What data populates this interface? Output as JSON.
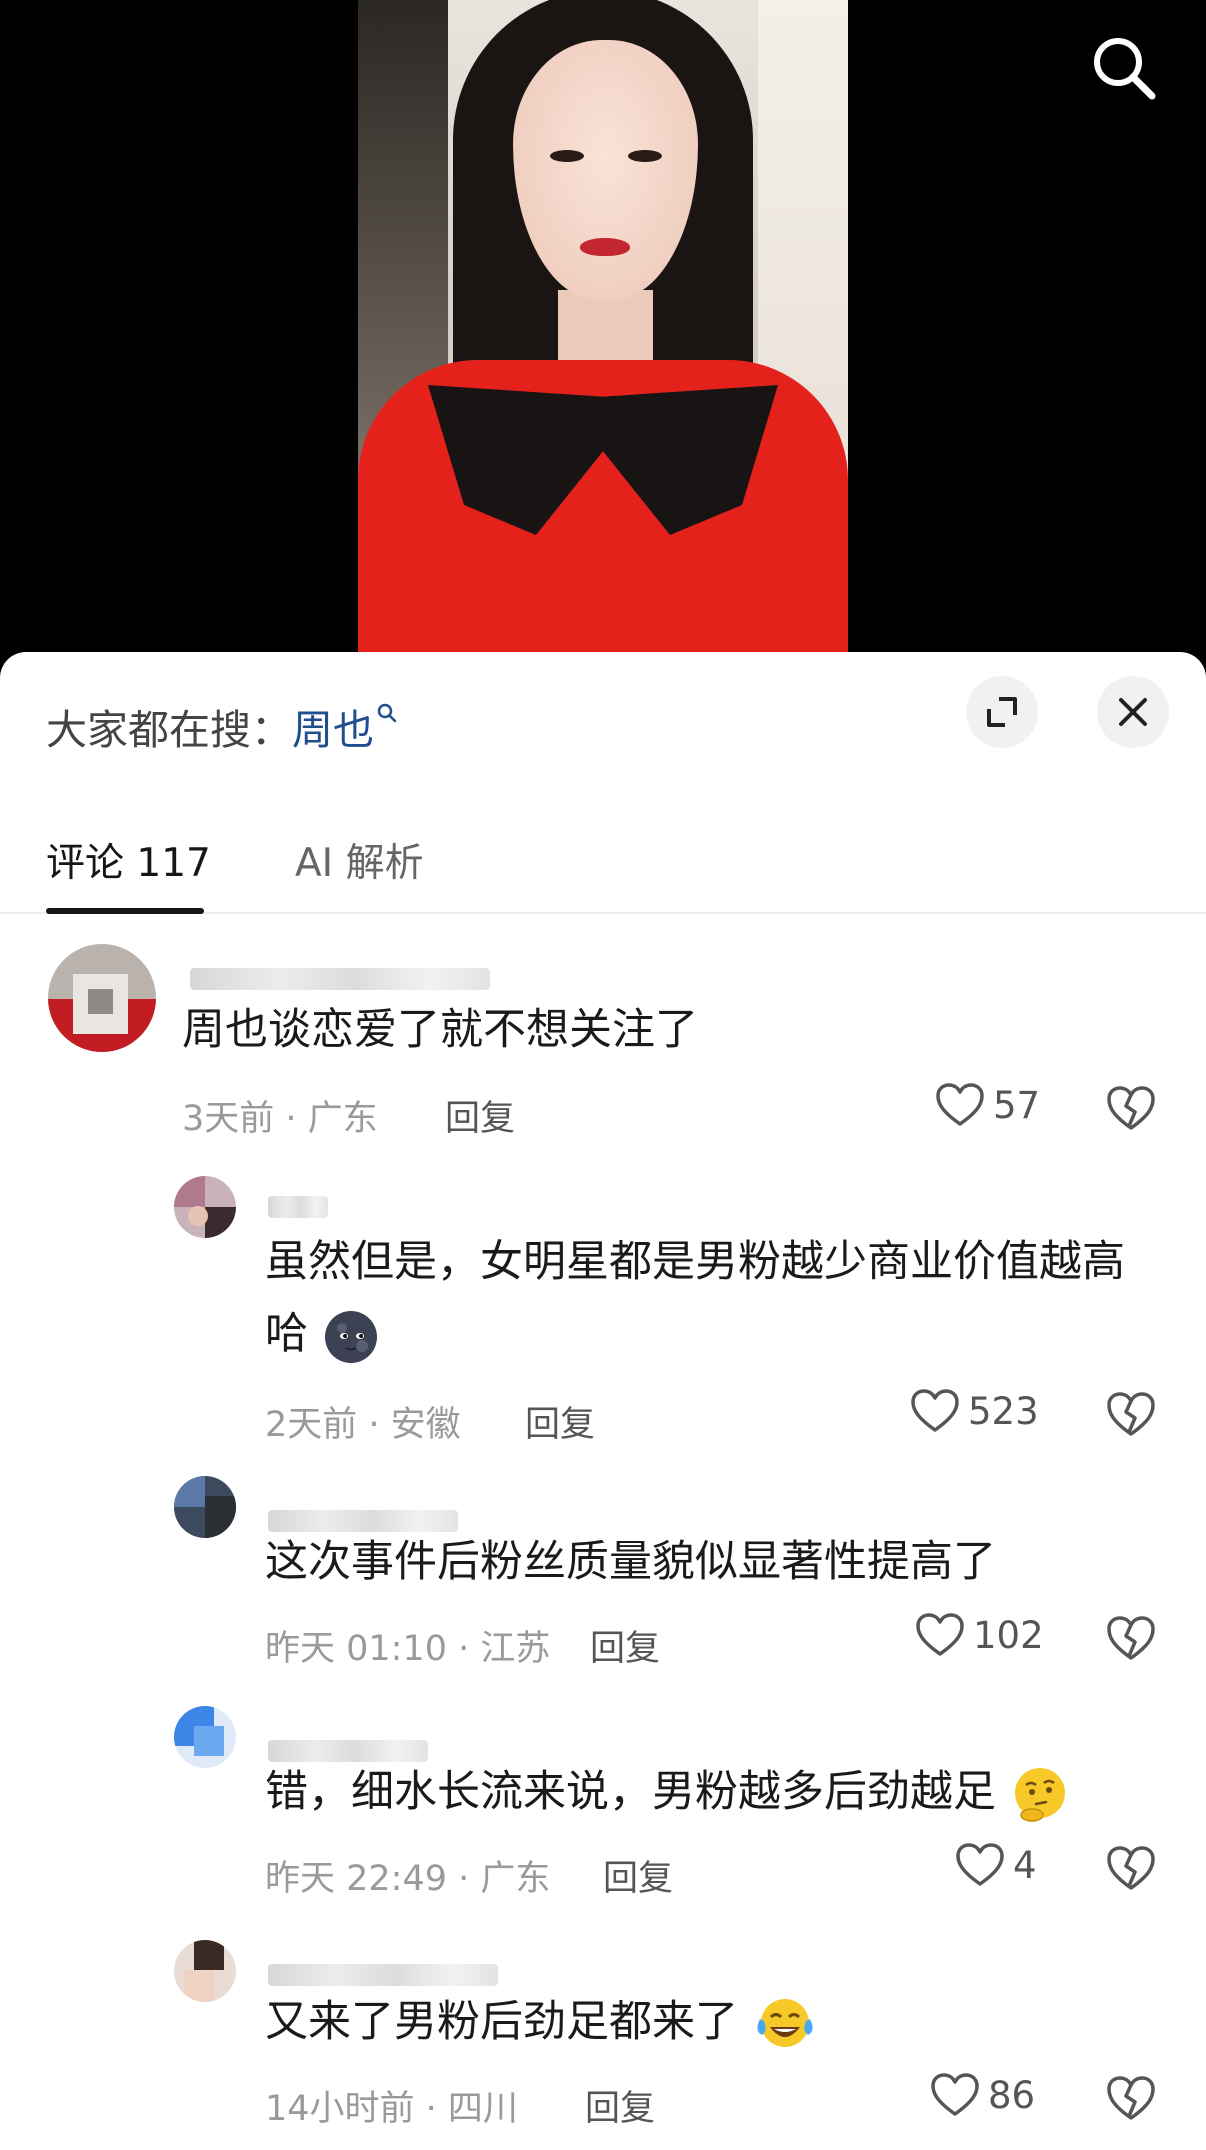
{
  "search_bar": {
    "prefix": "大家都在搜：",
    "keyword": "周也"
  },
  "tabs": [
    {
      "label": "评论 117"
    },
    {
      "label": "AI 解析"
    }
  ],
  "comments": [
    {
      "text": "周也谈恋爱了就不想关注了",
      "meta": "3天前 · 广东",
      "reply": "回复",
      "likes": "57"
    },
    {
      "text": "虽然但是，女明星都是男粉越少商业价值越高",
      "text2": "哈",
      "meta": "2天前 · 安徽",
      "reply": "回复",
      "likes": "523"
    },
    {
      "text": "这次事件后粉丝质量貌似显著性提高了",
      "meta": "昨天 01:10 · 江苏",
      "reply": "回复",
      "likes": "102"
    },
    {
      "text": "错，细水长流来说，男粉越多后劲越足",
      "meta": "昨天 22:49 · 广东",
      "reply": "回复",
      "likes": "4"
    },
    {
      "text": "又来了男粉后劲足都来了",
      "meta": "14小时前 · 四川",
      "reply": "回复",
      "likes": "86"
    }
  ],
  "icons": {
    "search": "search-icon",
    "expand": "expand-icon",
    "close": "close-icon",
    "like": "heart-icon",
    "dislike": "broken-heart-icon"
  },
  "colors": {
    "keyword": "#1f4f8f",
    "meta": "#9a9a9a",
    "text": "#1a1a1a"
  }
}
